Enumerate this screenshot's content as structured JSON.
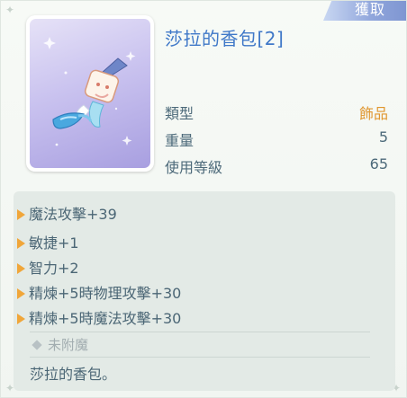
{
  "header": {
    "obtain_label": "獲取"
  },
  "item": {
    "name": "莎拉的香包[2]",
    "icon": "sachet-item-icon",
    "stats": [
      {
        "label": "類型",
        "value": "飾品"
      },
      {
        "label": "重量",
        "value": "5"
      },
      {
        "label": "使用等級",
        "value": "65"
      }
    ]
  },
  "effects": [
    "魔法攻擊+39",
    "敏捷+1",
    "智力+2",
    "精煉+5時物理攻擊+30",
    "精煉+5時魔法攻擊+30"
  ],
  "enchant_status": "未附魔",
  "description": "莎拉的香包。",
  "colors": {
    "name": "#3f78c8",
    "type_value": "#e0962f",
    "bullet": "#f0a63a",
    "text": "#4b6675"
  }
}
